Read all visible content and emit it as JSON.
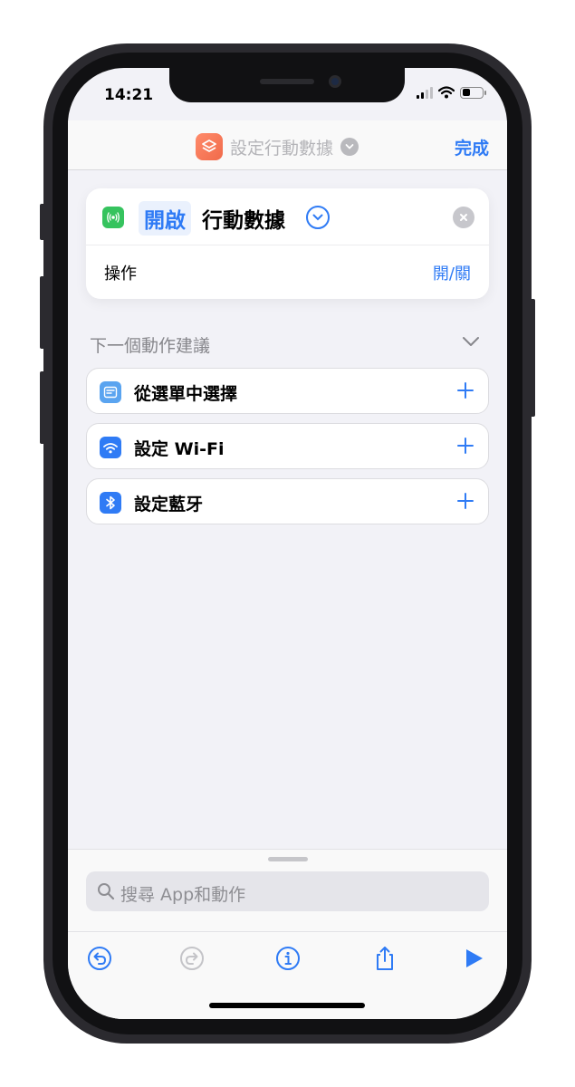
{
  "status": {
    "time": "14:21"
  },
  "nav": {
    "title": "設定行動數據",
    "done_label": "完成"
  },
  "action_card": {
    "token": "開啟",
    "title": "行動數據",
    "operation_label": "操作",
    "operation_value": "開/關"
  },
  "suggestions": {
    "header": "下一個動作建議",
    "items": [
      {
        "label": "從選單中選擇",
        "icon": "menu-list-icon",
        "color": "#5aa4f0"
      },
      {
        "label": "設定 Wi-Fi",
        "icon": "wifi-icon",
        "color": "#2f7bf5"
      },
      {
        "label": "設定藍牙",
        "icon": "bluetooth-icon",
        "color": "#2f7bf5"
      }
    ]
  },
  "search": {
    "placeholder": "搜尋 App和動作"
  },
  "colors": {
    "accent": "#2f7bf5",
    "cellular": "#36c35e",
    "shortcut": "#f06a4a"
  }
}
